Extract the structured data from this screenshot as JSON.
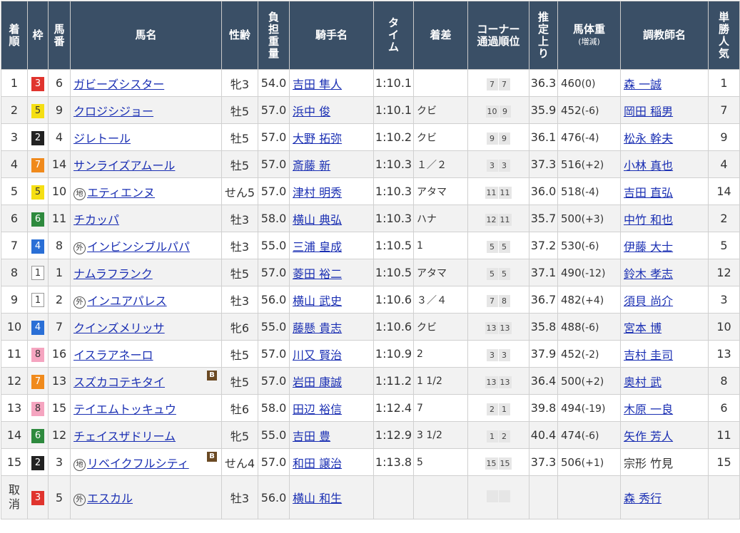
{
  "headers": {
    "rank": "着\n順",
    "waku": "枠",
    "umaban": "馬\n番",
    "horse": "馬名",
    "sexage": "性齢",
    "weight": "負\n担\n重\n量",
    "jockey": "騎手名",
    "time": "タ\nイ\nム",
    "margin": "着差",
    "corner": "コーナー\n通過順位",
    "last3f": "推\n定\n上\nり",
    "bodyweight": "馬体重",
    "bodyweight_sub": "(増減)",
    "trainer": "調教師名",
    "popularity": "単\n勝\n人\n気"
  },
  "rows": [
    {
      "rank": "1",
      "waku": "3",
      "umaban": "6",
      "mark": "",
      "horse": "ガビーズシスター",
      "blinker": false,
      "sexage": "牝3",
      "weight": "54.0",
      "jockey": "吉田 隼人",
      "time": "1:10.1",
      "margin": "",
      "c1": "7",
      "c2": "7",
      "last3f": "36.3",
      "bw": "460",
      "diff": "(0)",
      "trainer": "森 一誠",
      "trainer_link": true,
      "pop": "1"
    },
    {
      "rank": "2",
      "waku": "5",
      "umaban": "9",
      "mark": "",
      "horse": "クロジシジョー",
      "blinker": false,
      "sexage": "牡5",
      "weight": "57.0",
      "jockey": "浜中 俊",
      "time": "1:10.1",
      "margin": "クビ",
      "c1": "10",
      "c2": "9",
      "last3f": "35.9",
      "bw": "452",
      "diff": "(-6)",
      "trainer": "岡田 稲男",
      "trainer_link": true,
      "pop": "7"
    },
    {
      "rank": "3",
      "waku": "2",
      "umaban": "4",
      "mark": "",
      "horse": "ジレトール",
      "blinker": false,
      "sexage": "牡5",
      "weight": "57.0",
      "jockey": "大野 拓弥",
      "time": "1:10.2",
      "margin": "クビ",
      "c1": "9",
      "c2": "9",
      "last3f": "36.1",
      "bw": "476",
      "diff": "(-4)",
      "trainer": "松永 幹夫",
      "trainer_link": true,
      "pop": "9"
    },
    {
      "rank": "4",
      "waku": "7",
      "umaban": "14",
      "mark": "",
      "horse": "サンライズアムール",
      "blinker": false,
      "sexage": "牡5",
      "weight": "57.0",
      "jockey": "斎藤 新",
      "time": "1:10.3",
      "margin": "１／２",
      "c1": "3",
      "c2": "3",
      "last3f": "37.3",
      "bw": "516",
      "diff": "(+2)",
      "trainer": "小林 真也",
      "trainer_link": true,
      "pop": "4"
    },
    {
      "rank": "5",
      "waku": "5",
      "umaban": "10",
      "mark": "地",
      "horse": "エティエンヌ",
      "blinker": false,
      "sexage": "せん5",
      "weight": "57.0",
      "jockey": "津村 明秀",
      "time": "1:10.3",
      "margin": "アタマ",
      "c1": "11",
      "c2": "11",
      "last3f": "36.0",
      "bw": "518",
      "diff": "(-4)",
      "trainer": "吉田 直弘",
      "trainer_link": true,
      "pop": "14"
    },
    {
      "rank": "6",
      "waku": "6",
      "umaban": "11",
      "mark": "",
      "horse": "チカッパ",
      "blinker": false,
      "sexage": "牡3",
      "weight": "58.0",
      "jockey": "横山 典弘",
      "time": "1:10.3",
      "margin": "ハナ",
      "c1": "12",
      "c2": "11",
      "last3f": "35.7",
      "bw": "500",
      "diff": "(+3)",
      "trainer": "中竹 和也",
      "trainer_link": true,
      "pop": "2"
    },
    {
      "rank": "7",
      "waku": "4",
      "umaban": "8",
      "mark": "外",
      "horse": "インビンシブルパパ",
      "blinker": false,
      "sexage": "牡3",
      "weight": "55.0",
      "jockey": "三浦 皇成",
      "time": "1:10.5",
      "margin": "1",
      "c1": "5",
      "c2": "5",
      "last3f": "37.2",
      "bw": "530",
      "diff": "(-6)",
      "trainer": "伊藤 大士",
      "trainer_link": true,
      "pop": "5"
    },
    {
      "rank": "8",
      "waku": "1",
      "umaban": "1",
      "mark": "",
      "horse": "ナムラフランク",
      "blinker": false,
      "sexage": "牡5",
      "weight": "57.0",
      "jockey": "菱田 裕二",
      "time": "1:10.5",
      "margin": "アタマ",
      "c1": "5",
      "c2": "5",
      "last3f": "37.1",
      "bw": "490",
      "diff": "(-12)",
      "trainer": "鈴木 孝志",
      "trainer_link": true,
      "pop": "12"
    },
    {
      "rank": "9",
      "waku": "1",
      "umaban": "2",
      "mark": "外",
      "horse": "インユアパレス",
      "blinker": false,
      "sexage": "牡3",
      "weight": "56.0",
      "jockey": "横山 武史",
      "time": "1:10.6",
      "margin": "３／４",
      "c1": "7",
      "c2": "8",
      "last3f": "36.7",
      "bw": "482",
      "diff": "(+4)",
      "trainer": "須貝 尚介",
      "trainer_link": true,
      "pop": "3"
    },
    {
      "rank": "10",
      "waku": "4",
      "umaban": "7",
      "mark": "",
      "horse": "クインズメリッサ",
      "blinker": false,
      "sexage": "牝6",
      "weight": "55.0",
      "jockey": "藤懸 貴志",
      "time": "1:10.6",
      "margin": "クビ",
      "c1": "13",
      "c2": "13",
      "last3f": "35.8",
      "bw": "488",
      "diff": "(-6)",
      "trainer": "宮本 博",
      "trainer_link": true,
      "pop": "10"
    },
    {
      "rank": "11",
      "waku": "8",
      "umaban": "16",
      "mark": "",
      "horse": "イスラアネーロ",
      "blinker": false,
      "sexage": "牡5",
      "weight": "57.0",
      "jockey": "川又 賢治",
      "time": "1:10.9",
      "margin": "2",
      "c1": "3",
      "c2": "3",
      "last3f": "37.9",
      "bw": "452",
      "diff": "(-2)",
      "trainer": "吉村 圭司",
      "trainer_link": true,
      "pop": "13"
    },
    {
      "rank": "12",
      "waku": "7",
      "umaban": "13",
      "mark": "",
      "horse": "スズカコテキタイ",
      "blinker": true,
      "sexage": "牡5",
      "weight": "57.0",
      "jockey": "岩田 康誠",
      "time": "1:11.2",
      "margin": "1 1/2",
      "c1": "13",
      "c2": "13",
      "last3f": "36.4",
      "bw": "500",
      "diff": "(+2)",
      "trainer": "奥村 武",
      "trainer_link": true,
      "pop": "8"
    },
    {
      "rank": "13",
      "waku": "8",
      "umaban": "15",
      "mark": "",
      "horse": "テイエムトッキュウ",
      "blinker": false,
      "sexage": "牡6",
      "weight": "58.0",
      "jockey": "田辺 裕信",
      "time": "1:12.4",
      "margin": "7",
      "c1": "2",
      "c2": "1",
      "last3f": "39.8",
      "bw": "494",
      "diff": "(-19)",
      "trainer": "木原 一良",
      "trainer_link": true,
      "pop": "6"
    },
    {
      "rank": "14",
      "waku": "6",
      "umaban": "12",
      "mark": "",
      "horse": "チェイスザドリーム",
      "blinker": false,
      "sexage": "牝5",
      "weight": "55.0",
      "jockey": "吉田 豊",
      "time": "1:12.9",
      "margin": "3 1/2",
      "c1": "1",
      "c2": "2",
      "last3f": "40.4",
      "bw": "474",
      "diff": "(-6)",
      "trainer": "矢作 芳人",
      "trainer_link": true,
      "pop": "11"
    },
    {
      "rank": "15",
      "waku": "2",
      "umaban": "3",
      "mark": "地",
      "horse": "リベイクフルシティ",
      "blinker": true,
      "sexage": "せん4",
      "weight": "57.0",
      "jockey": "和田 譲治",
      "time": "1:13.8",
      "margin": "5",
      "c1": "15",
      "c2": "15",
      "last3f": "37.3",
      "bw": "506",
      "diff": "(+1)",
      "trainer": "宗形 竹見",
      "trainer_link": false,
      "pop": "15"
    },
    {
      "rank": "取\n消",
      "waku": "3",
      "umaban": "5",
      "mark": "外",
      "horse": "エスカル",
      "blinker": false,
      "sexage": "牡3",
      "weight": "56.0",
      "jockey": "横山 和生",
      "time": "",
      "margin": "",
      "c1": "",
      "c2": "",
      "last3f": "",
      "bw": "",
      "diff": "",
      "trainer": "森 秀行",
      "trainer_link": true,
      "pop": ""
    }
  ],
  "blinker_label": "B"
}
